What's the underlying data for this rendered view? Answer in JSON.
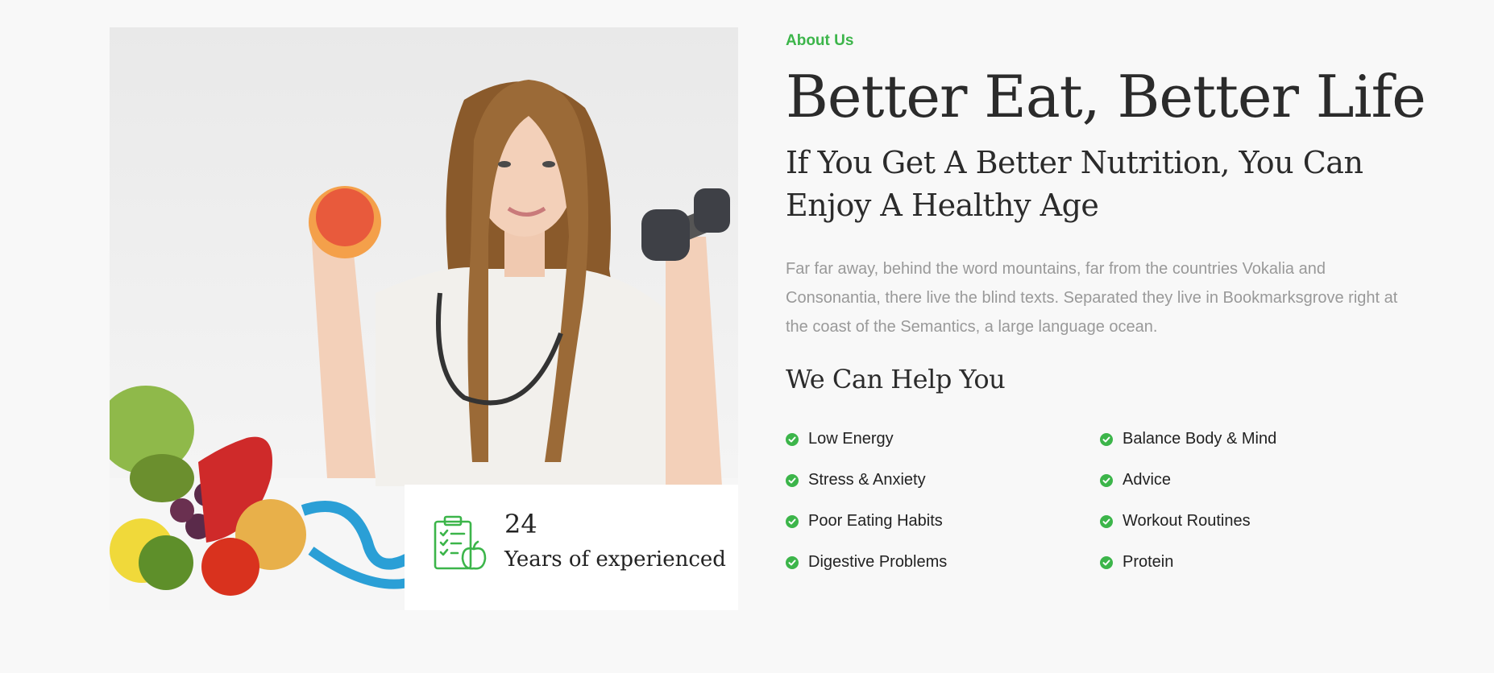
{
  "about": {
    "eyebrow": "About Us",
    "title": "Better Eat, Better Life",
    "subtitle": "If You Get A Better Nutrition, You Can Enjoy A Healthy Age",
    "description": "Far far away, behind the word mountains, far from the countries Vokalia and Consonantia, there live the blind texts. Separated they live in Bookmarksgrove right at the coast of the Semantics, a large language ocean.",
    "help_title": "We Can Help You"
  },
  "experience": {
    "number": "24",
    "label": "Years of experienced",
    "icon": "clipboard-apple-icon"
  },
  "features": {
    "left": [
      "Low Energy",
      "Stress & Anxiety",
      "Poor Eating Habits",
      "Digestive Problems"
    ],
    "right": [
      "Balance Body & Mind",
      "Advice",
      "Workout Routines",
      "Protein"
    ]
  },
  "colors": {
    "accent": "#3cb54a",
    "heading": "#2b2b2b",
    "body_text": "#999999",
    "background": "#f8f8f8"
  }
}
